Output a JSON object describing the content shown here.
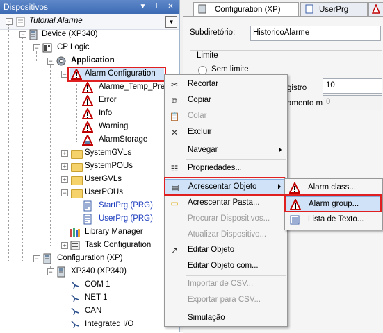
{
  "panel": {
    "title": "Dispositivos"
  },
  "tree": {
    "project": "Tutorial Alarme",
    "device": "Device (XP340)",
    "plc_logic": "CP Logic",
    "application": "Application",
    "alarm_config": "Alarm Configuration",
    "alarm_temp": "Alarme_Temp_Press",
    "error": "Error",
    "info": "Info",
    "warning": "Warning",
    "alarm_storage": "AlarmStorage",
    "system_gvls": "SystemGVLs",
    "system_pous": "SystemPOUs",
    "user_gvls": "UserGVLs",
    "user_pous": "UserPOUs",
    "start_prg": "StartPrg (PRG)",
    "user_prg": "UserPrg (PRG)",
    "library_manager": "Library Manager",
    "task_config": "Task Configuration",
    "configuration": "Configuration (XP)",
    "xp340": "XP340 (XP340)",
    "com1": "COM 1",
    "net1": "NET 1",
    "can": "CAN",
    "integrated_io": "Integrated I/O"
  },
  "tabs": [
    {
      "label": "Configuration (XP)"
    },
    {
      "label": "UserPrg"
    }
  ],
  "form": {
    "subdir_label": "Subdiretório:",
    "subdir_value": "HistoricoAlarme",
    "limit_group": "Limite",
    "no_limit": "Sem limite",
    "registro_label": "gistro",
    "registro_value": "10",
    "amento_label": "amento máx",
    "amento_value": "0"
  },
  "context_menu": {
    "cut": "Recortar",
    "copy": "Copiar",
    "paste": "Colar",
    "delete": "Excluir",
    "navigate": "Navegar",
    "properties": "Propriedades...",
    "add_object": "Acrescentar Objeto",
    "add_folder": "Acrescentar Pasta...",
    "search_devices": "Procurar Dispositivos...",
    "update_device": "Atualizar Dispositivo...",
    "edit_object": "Editar Objeto",
    "edit_object_with": "Editar Objeto com...",
    "import_csv": "Importar de CSV...",
    "export_csv": "Exportar para CSV...",
    "simulation": "Simulação"
  },
  "sub_menu": {
    "alarm_class": "Alarm class...",
    "alarm_group": "Alarm group...",
    "text_list": "Lista de Texto..."
  },
  "colors": {
    "header_blue": "#3c6bb5",
    "highlight_red": "#e02020",
    "menu_highlight": "#cfe2f7"
  }
}
